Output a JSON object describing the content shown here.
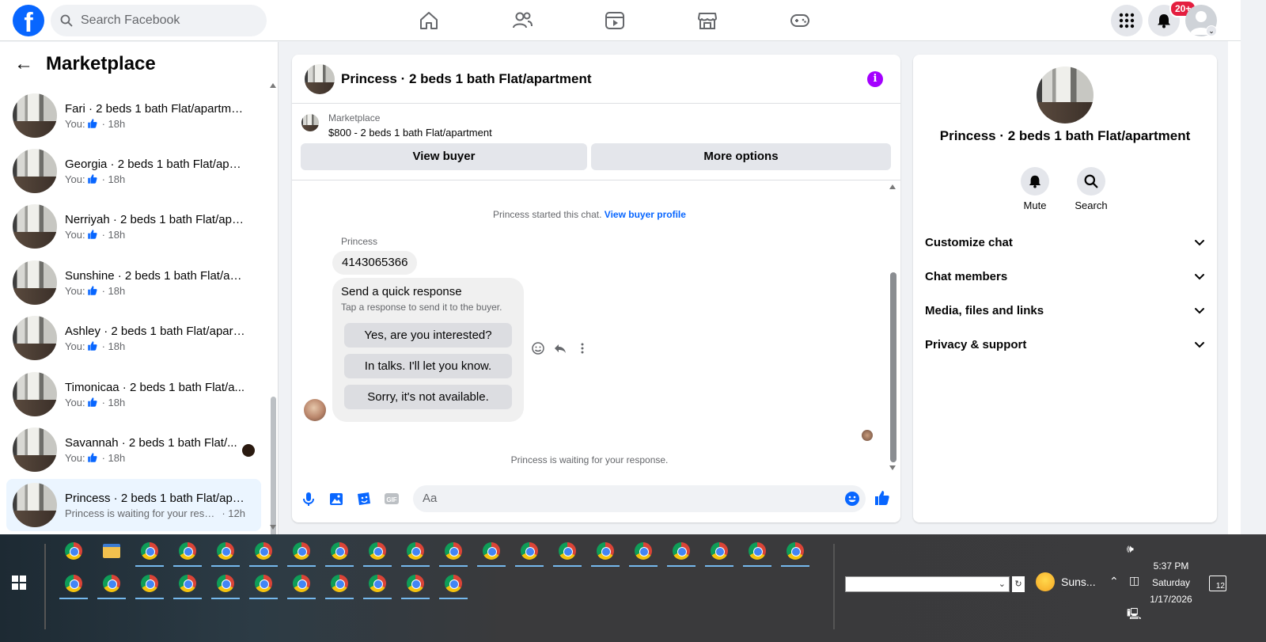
{
  "topbar": {
    "logo_letter": "f",
    "search_placeholder": "Search Facebook",
    "notif_badge": "20+",
    "nav_icons": [
      "home-icon",
      "friends-icon",
      "video-icon",
      "marketplace-icon",
      "gaming-icon"
    ]
  },
  "sidebar": {
    "title": "Marketplace",
    "conversations": [
      {
        "name": "Fari · 2 beds 1 bath Flat/apartment",
        "prefix": "You:",
        "time": "· 18h"
      },
      {
        "name": "Georgia · 2 beds 1 bath Flat/apa...",
        "prefix": "You:",
        "time": "· 18h"
      },
      {
        "name": "Nerriyah · 2 beds 1 bath Flat/apa...",
        "prefix": "You:",
        "time": "· 18h"
      },
      {
        "name": "Sunshine · 2 beds 1 bath Flat/ap...",
        "prefix": "You:",
        "time": "· 18h"
      },
      {
        "name": "Ashley · 2 beds 1 bath Flat/apart...",
        "prefix": "You:",
        "time": "· 18h"
      },
      {
        "name": "Timonicaa · 2 beds 1 bath Flat/a...",
        "prefix": "You:",
        "time": "· 18h"
      },
      {
        "name": "Savannah · 2 beds 1 bath Flat/...",
        "prefix": "You:",
        "time": "· 18h"
      },
      {
        "name": "Princess · 2 beds 1 bath Flat/apa...",
        "sub": "Princess is waiting for your respo...",
        "time": "· 12h"
      }
    ]
  },
  "chat": {
    "title": "Princess · 2 beds 1 bath Flat/apartment",
    "marketplace_label": "Marketplace",
    "listing": "$800 - 2 beds 1 bath Flat/apartment",
    "view_buyer": "View buyer",
    "more_options": "More options",
    "started_text": "Princess started this chat.",
    "view_profile": "View buyer profile",
    "sender": "Princess",
    "phone_message": "4143065366",
    "quick_title": "Send a quick response",
    "quick_sub": "Tap a response to send it to the buyer.",
    "quick_responses": [
      "Yes, are you interested?",
      "In talks. I'll let you know.",
      "Sorry, it's not available."
    ],
    "waiting_text": "Princess is waiting for your response.",
    "input_placeholder": "Aa"
  },
  "info": {
    "name": "Princess · 2 beds 1 bath Flat/apartment",
    "mute": "Mute",
    "search": "Search",
    "sections": [
      "Customize chat",
      "Chat members",
      "Media, files and links",
      "Privacy & support"
    ]
  },
  "taskbar": {
    "weather": "Suns...",
    "time": "5:37 PM",
    "day": "Saturday",
    "date": "1/17/2026",
    "notif_count": "12"
  },
  "colors": {
    "brand": "#0866ff",
    "info_accent": "#a400ff",
    "badge": "#e41e3f",
    "active_row": "#ebf5ff"
  }
}
